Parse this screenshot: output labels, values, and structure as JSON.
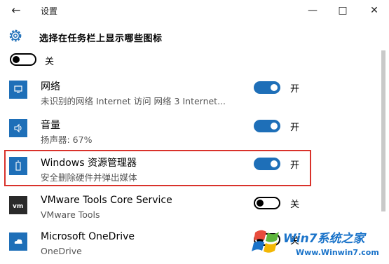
{
  "window": {
    "title": "设置"
  },
  "header": {
    "title": "选择在任务栏上显示哪些图标"
  },
  "top_toggle": {
    "state": "off",
    "label": "关"
  },
  "items": [
    {
      "name": "网络",
      "sub": "未识别的网络 Internet 访问   网络  3 Internet...",
      "state": "on",
      "label": "开",
      "icon": "network-icon"
    },
    {
      "name": "音量",
      "sub": "扬声器: 67%",
      "state": "on",
      "label": "开",
      "icon": "speaker-icon"
    },
    {
      "name": "Windows 资源管理器",
      "sub": "安全删除硬件并弹出媒体",
      "state": "on",
      "label": "开",
      "icon": "usb-drive-icon"
    },
    {
      "name": "VMware Tools Core Service",
      "sub": "VMware Tools",
      "state": "off",
      "label": "关",
      "icon": "vmware-icon"
    },
    {
      "name": "Microsoft OneDrive",
      "sub": "OneDrive",
      "state": "off",
      "label": "关",
      "icon": "cloud-icon"
    }
  ],
  "watermark": {
    "brand": "Win7系统之家",
    "url": "Www.Winwin7.com"
  },
  "colors": {
    "accent": "#1e6fb8",
    "highlight": "#d9322b"
  }
}
